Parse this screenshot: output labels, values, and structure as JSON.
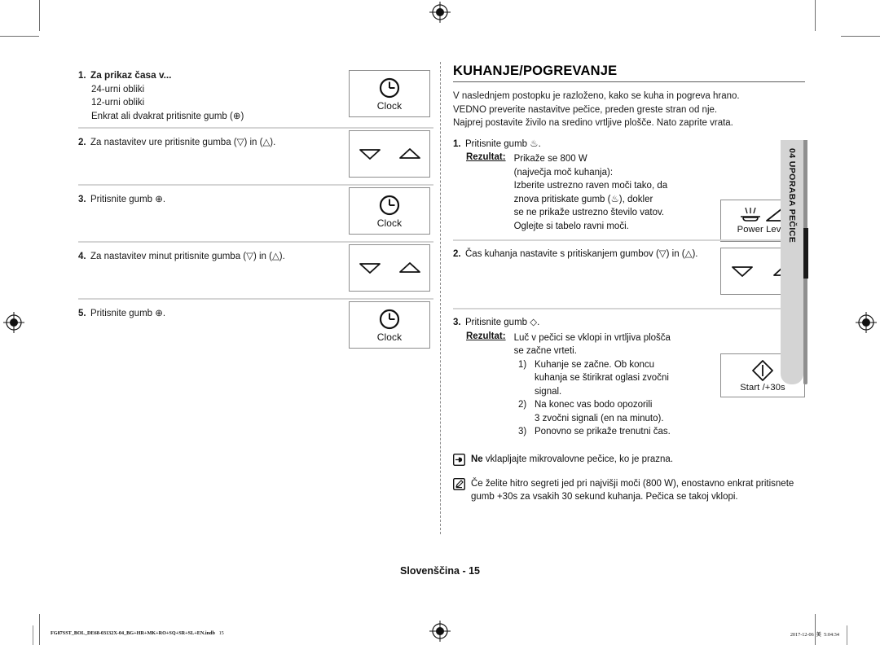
{
  "left_column": {
    "steps": [
      {
        "num": "1.",
        "title": "Za prikaz časa v...",
        "lines": [
          "24-urni obliki",
          "12-urni obliki",
          "Enkrat ali dvakrat pritisnite gumb (⊕)"
        ],
        "key": {
          "label": "Clock",
          "icon": "clock-icon"
        }
      },
      {
        "num": "2.",
        "text": "Za nastavitev ure pritisnite gumba (▽) in (△).",
        "key": {
          "label": "",
          "icon": "up-down-arrows-icon"
        }
      },
      {
        "num": "3.",
        "text": "Pritisnite gumb ⊕.",
        "key": {
          "label": "Clock",
          "icon": "clock-icon"
        }
      },
      {
        "num": "4.",
        "text": "Za nastavitev minut pritisnite gumba (▽) in (△).",
        "key": {
          "label": "",
          "icon": "up-down-arrows-icon"
        }
      },
      {
        "num": "5.",
        "text": "Pritisnite gumb ⊕.",
        "key": {
          "label": "Clock",
          "icon": "clock-icon"
        }
      }
    ]
  },
  "right_column": {
    "section_title": "KUHANJE/POGREVANJE",
    "intro": [
      "V naslednjem postopku je razloženo, kako se kuha in pogreva hrano.",
      "VEDNO preverite nastavitve pečice, preden greste stran od nje.",
      "Najprej postavite živilo na sredino vrtljive plošče. Nato zaprite vrata."
    ],
    "step1": {
      "num": "1.",
      "text": "Pritisnite gumb ♨.",
      "result_label": "Rezultat:",
      "result_lines": [
        "Prikaže se 800 W",
        "(največja moč kuhanja):",
        "Izberite ustrezno raven moči tako, da",
        "znova pritiskate gumb (♨), dokler",
        "se ne prikaže ustrezno število vatov.",
        "Oglejte si tabelo ravni moči."
      ],
      "key": {
        "label": "Power Level",
        "icon": "power-level-icon"
      }
    },
    "step2": {
      "num": "2.",
      "text": "Čas kuhanja nastavite s pritiskanjem gumbov (▽) in (△).",
      "key": {
        "label": "",
        "icon": "up-down-arrows-icon"
      }
    },
    "step3": {
      "num": "3.",
      "text": "Pritisnite gumb ◇.",
      "result_label": "Rezultat:",
      "result_lines": [
        "Luč v pečici se vklopi in vrtljiva plošča",
        "se začne vrteti."
      ],
      "numbered": [
        {
          "marker": "1)",
          "lines": [
            "Kuhanje se začne. Ob koncu",
            "kuhanja se štirikrat oglasi zvočni",
            "signal."
          ]
        },
        {
          "marker": "2)",
          "lines": [
            "Na konec vas bodo opozorili",
            "3 zvočni signali (en na minuto)."
          ]
        },
        {
          "marker": "3)",
          "lines": [
            "Ponovno se prikaže trenutni čas."
          ]
        }
      ],
      "key": {
        "label": "Start /+30s",
        "icon": "start-icon"
      }
    },
    "notes": [
      {
        "icon": "pointing-hand-icon",
        "bold_lead": "Ne",
        "text": " vklapljajte mikrovalovne pečice, ko je prazna."
      },
      {
        "icon": "note-pencil-icon",
        "bold_lead": "",
        "text": "Če želite hitro segreti jed pri najvišji moči (800 W), enostavno enkrat pritisnete gumb +30s za vsakih 30 sekund kuhanja. Pečica se takoj vklopi."
      }
    ]
  },
  "side_tab": {
    "text": "04  UPORABA PEČICE"
  },
  "footer": {
    "page_label": "Slovenščina - 15",
    "print_file": "FG87SST_BOL_DE68-03132X-04_BG+HR+MK+RO+SQ+SR+SL+EN.indb",
    "print_page": "15",
    "print_date": "2017-12-06",
    "print_glyph": "美",
    "print_time": "5:04:34"
  },
  "colors": {
    "rule": "#d5d5d5",
    "tab_bg": "#d4d4d4",
    "tab_edge": "#8f8f8f",
    "tab_marker": "#1a1a1a"
  }
}
